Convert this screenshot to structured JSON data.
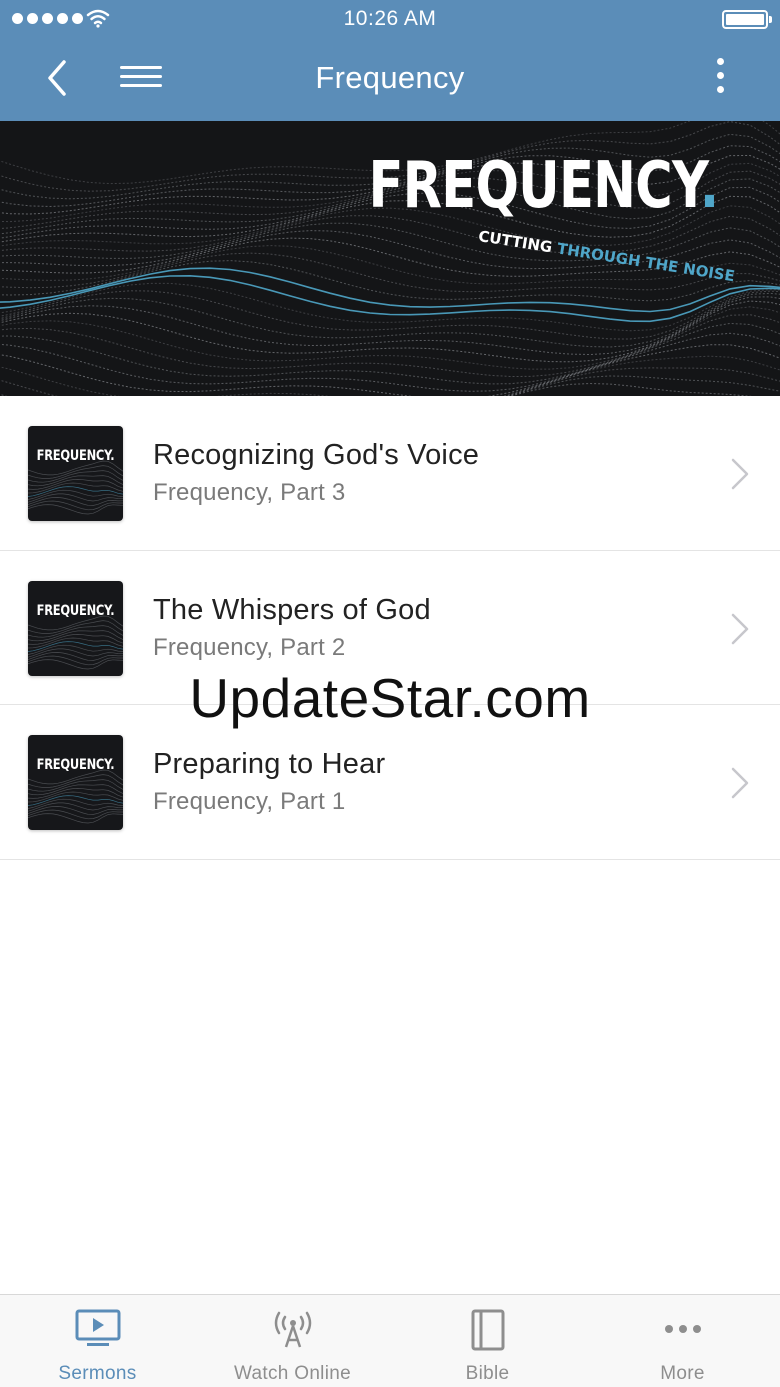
{
  "status_bar": {
    "time": "10:26 AM"
  },
  "nav": {
    "title": "Frequency"
  },
  "banner": {
    "brand": "FREQUENCY",
    "brand_dot": ".",
    "tagline_a": "CUTTING",
    "tagline_b": "THROUGH THE NOISE"
  },
  "sermons": [
    {
      "title": "Recognizing God's Voice",
      "subtitle": "Frequency, Part 3",
      "thumb": "FREQUENCY."
    },
    {
      "title": "The Whispers of God",
      "subtitle": "Frequency, Part 2",
      "thumb": "FREQUENCY."
    },
    {
      "title": "Preparing to Hear",
      "subtitle": "Frequency, Part 1",
      "thumb": "FREQUENCY."
    }
  ],
  "watermark": "UpdateStar.com",
  "tabs": [
    {
      "label": "Sermons",
      "icon": "tv-play-icon",
      "active": true
    },
    {
      "label": "Watch Online",
      "icon": "broadcast-tower-icon",
      "active": false
    },
    {
      "label": "Bible",
      "icon": "book-icon",
      "active": false
    },
    {
      "label": "More",
      "icon": "ellipsis-icon",
      "active": false
    }
  ],
  "colors": {
    "accent": "#5b8db8",
    "banner_bg": "#141517",
    "brand_dot": "#4fa6c9",
    "tab_inactive": "#8e8e8e"
  }
}
